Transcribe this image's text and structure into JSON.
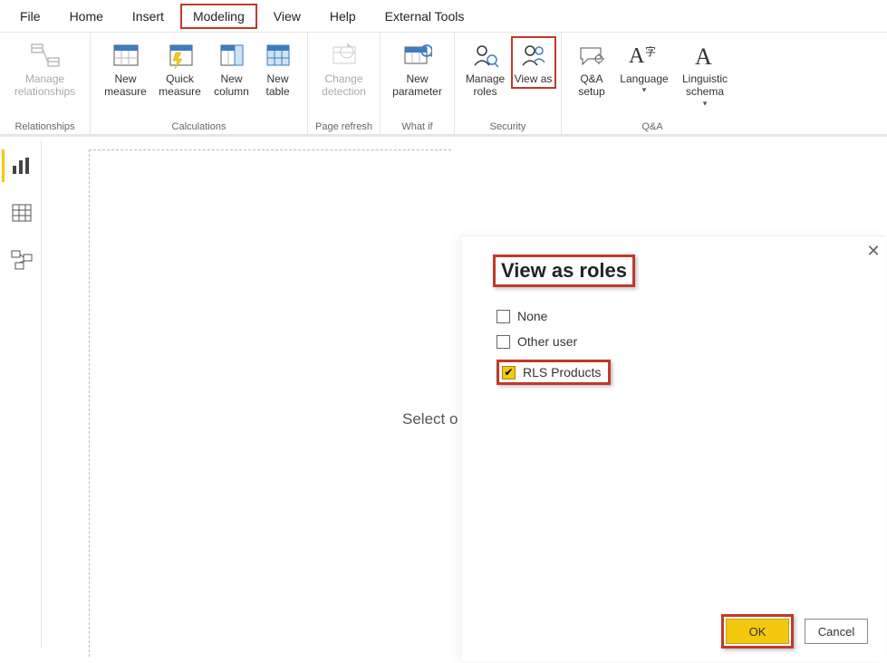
{
  "tabs": {
    "file": "File",
    "home": "Home",
    "insert": "Insert",
    "modeling": "Modeling",
    "view": "View",
    "help": "Help",
    "external_tools": "External Tools"
  },
  "ribbon": {
    "relationships": {
      "group_label": "Relationships",
      "manage_relationships": "Manage relationships"
    },
    "calculations": {
      "group_label": "Calculations",
      "new_measure": "New measure",
      "quick_measure": "Quick measure",
      "new_column": "New column",
      "new_table": "New table"
    },
    "page_refresh": {
      "group_label": "Page refresh",
      "change_detection": "Change detection"
    },
    "what_if": {
      "group_label": "What if",
      "new_parameter": "New parameter"
    },
    "security": {
      "group_label": "Security",
      "manage_roles": "Manage roles",
      "view_as": "View as"
    },
    "qa": {
      "group_label": "Q&A",
      "qa_setup": "Q&A setup",
      "language": "Language",
      "linguistic_schema": "Linguistic schema"
    }
  },
  "canvas": {
    "hint": "Select o"
  },
  "dialog": {
    "title": "View as roles",
    "roles": {
      "none": "None",
      "other_user": "Other user",
      "rls_products": "RLS Products"
    },
    "ok": "OK",
    "cancel": "Cancel"
  },
  "colors": {
    "highlight": "#c0392b",
    "accent": "#f2c811"
  }
}
